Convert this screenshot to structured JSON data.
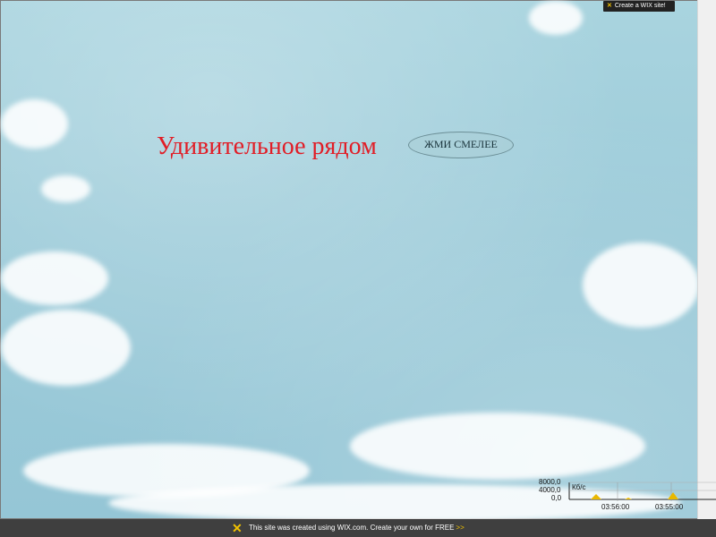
{
  "wix_badge": {
    "label": "Create a WIX site!",
    "icon": "wix-x-icon"
  },
  "headline": {
    "text": "Удивительное рядом"
  },
  "cta_button": {
    "label": "ЖМИ СМЕЛЕЕ"
  },
  "footer": {
    "text": "This site was created using WIX.com. Create your own for FREE",
    "arrows": ">>"
  },
  "traffic_widget": {
    "unit": "Кб/с",
    "y_ticks": [
      "8000,0",
      "4000,0",
      "0,0"
    ],
    "x_ticks": [
      "03:56:00",
      "03:55:00"
    ]
  },
  "colors": {
    "headline": "#e11d26",
    "footer_bg": "#3f3f3f",
    "wix_accent": "#f2c200"
  }
}
